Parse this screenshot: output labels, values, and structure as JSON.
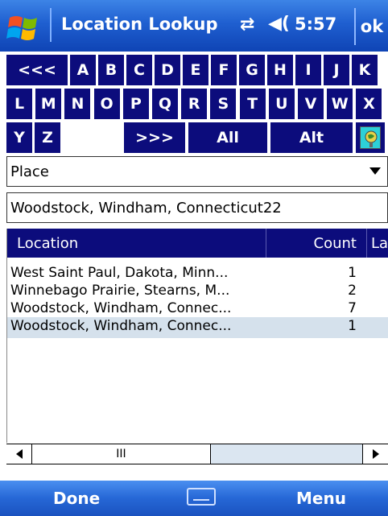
{
  "titlebar": {
    "title": "Location Lookup",
    "time": "5:57",
    "ok_label": "ok",
    "icons": [
      "windows-start-icon",
      "connectivity-icon",
      "volume-icon"
    ]
  },
  "keys": {
    "row1": [
      "<<<",
      "A",
      "B",
      "C",
      "D",
      "E",
      "F",
      "G",
      "H",
      "I",
      "J",
      "K"
    ],
    "row2": [
      "L",
      "M",
      "N",
      "O",
      "P",
      "Q",
      "R",
      "S",
      "T",
      "U",
      "V",
      "W",
      "X"
    ],
    "row3": [
      "Y",
      "Z",
      ">>>",
      "All",
      "Alt"
    ]
  },
  "dropdown": {
    "selected": "Place"
  },
  "search": {
    "value": "Woodstock, Windham, Connecticut22"
  },
  "list": {
    "columns": [
      "Location",
      "Count",
      "La"
    ],
    "rows": [
      {
        "location": "West Saint Paul, Dakota, Minn...",
        "count": "1",
        "selected": false
      },
      {
        "location": "Winnebago Prairie, Stearns, M...",
        "count": "2",
        "selected": false
      },
      {
        "location": "Woodstock, Windham, Connec...",
        "count": "7",
        "selected": false
      },
      {
        "location": "Woodstock, Windham, Connec...",
        "count": "1",
        "selected": true
      }
    ]
  },
  "scrollbar": {
    "thumb_glyph": "III"
  },
  "softkeys": {
    "left": "Done",
    "right": "Menu"
  },
  "colors": {
    "key_bg": "#0c0c7c",
    "titlebar_bg": "#1f5fd0",
    "selected_row": "#d5e1ec"
  }
}
